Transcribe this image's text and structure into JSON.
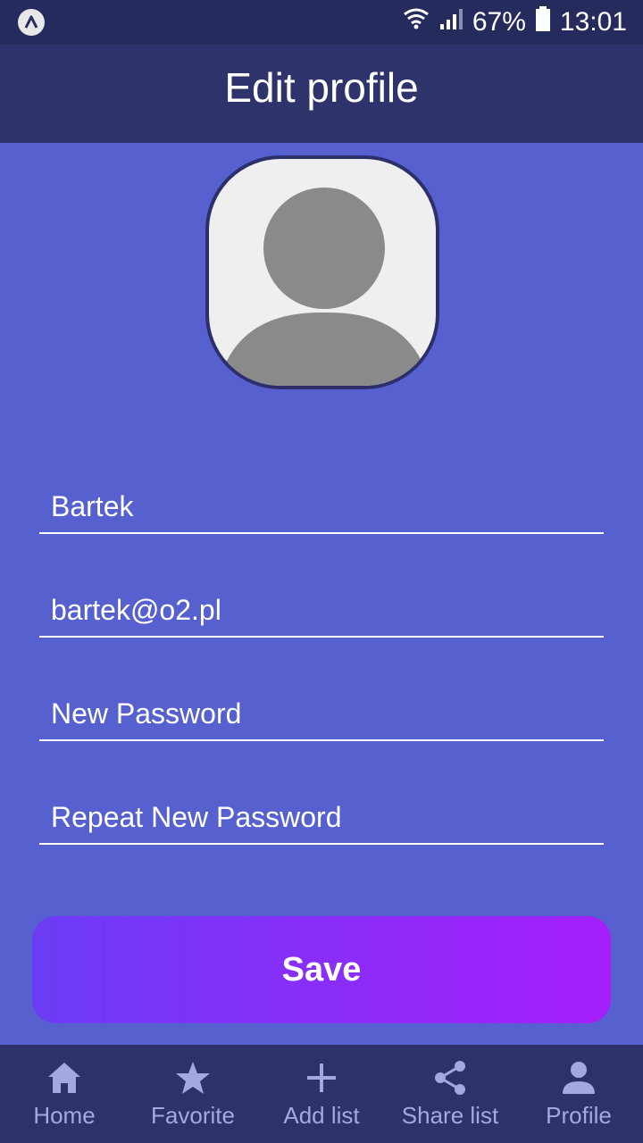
{
  "status_bar": {
    "battery": "67%",
    "time": "13:01"
  },
  "header": {
    "title": "Edit profile"
  },
  "form": {
    "name_value": "Bartek",
    "email_value": "bartek@o2.pl",
    "new_password_placeholder": "New Password",
    "repeat_password_placeholder": "Repeat New Password"
  },
  "save_label": "Save",
  "nav": {
    "items": [
      {
        "label": "Home",
        "icon": "home-icon"
      },
      {
        "label": "Favorite",
        "icon": "star-icon"
      },
      {
        "label": "Add list",
        "icon": "plus-icon"
      },
      {
        "label": "Share list",
        "icon": "share-icon"
      },
      {
        "label": "Profile",
        "icon": "person-icon"
      }
    ]
  },
  "colors": {
    "background": "#5661cf",
    "header": "#2f336b",
    "nav_bar": "#2e326a",
    "nav_icon": "#a3a8e2",
    "button_start": "#6c3cf5",
    "button_end": "#a61ffb"
  }
}
